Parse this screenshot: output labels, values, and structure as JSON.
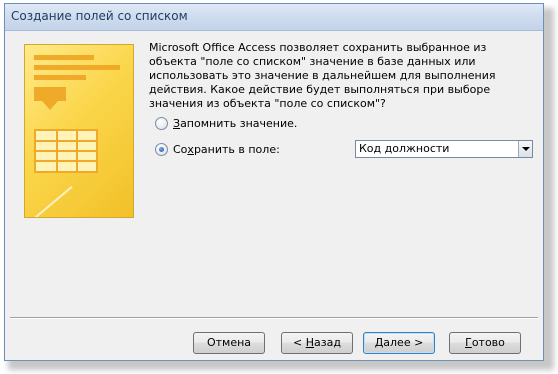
{
  "window": {
    "title": "Создание полей со списком"
  },
  "description": "Microsoft Office Access позволяет сохранить выбранное из объекта \"поле со списком\" значение в базе данных или использовать это значение в дальнейшем для выполнения действия.  Какое действие будет выполняться при выборе значения из объекта \"поле со списком\"?",
  "options": {
    "remember": {
      "before": "",
      "mnemonic": "З",
      "after": "апомнить значение.",
      "selected": false
    },
    "store": {
      "before": "Со",
      "mnemonic": "х",
      "after": "ранить в поле:",
      "selected": true
    }
  },
  "field_select": {
    "value": "Код должности"
  },
  "buttons": {
    "cancel": {
      "before": "",
      "mnemonic": "",
      "after": "Отмена"
    },
    "back": {
      "before": "< ",
      "mnemonic": "Н",
      "after": "азад"
    },
    "next": {
      "before": "",
      "mnemonic": "Д",
      "after": "алее >"
    },
    "finish": {
      "before": "",
      "mnemonic": "Г",
      "after": "отово"
    }
  },
  "icons": {
    "illustration": "wizard-combo-box-illustration",
    "dropdown": "chevron-down-icon"
  }
}
